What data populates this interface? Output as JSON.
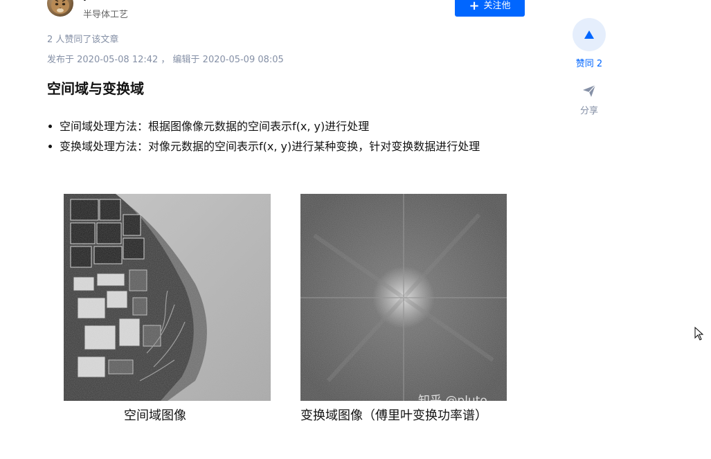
{
  "author": {
    "name": "pluto",
    "bio": "半导体工艺",
    "follow_label": "关注他"
  },
  "meta": {
    "likes_text": "2 人赞同了该文章",
    "dates_text": "发布于 2020-05-08 12:42 ， 编辑于 2020-05-09 08:05"
  },
  "article": {
    "heading": "空间域与变换域",
    "bullets": [
      "空间域处理方法：根据图像像元数据的空间表示f(x, y)进行处理",
      "变换域处理方法：对像元数据的空间表示f(x, y)进行某种变换，针对变换数据进行处理"
    ],
    "figure_left_caption": "空间域图像",
    "figure_right_caption": "变换域图像（傅里叶变换功率谱）",
    "watermark": "知乎 @pluto"
  },
  "sidebar": {
    "vote_label": "赞同 2",
    "share_label": "分享"
  },
  "colors": {
    "accent": "#0066ff",
    "muted": "#8590a6",
    "text": "#121212"
  },
  "icons": [
    "plus-icon",
    "upvote-triangle-icon",
    "share-paper-plane-icon",
    "mouse-cursor-icon"
  ]
}
